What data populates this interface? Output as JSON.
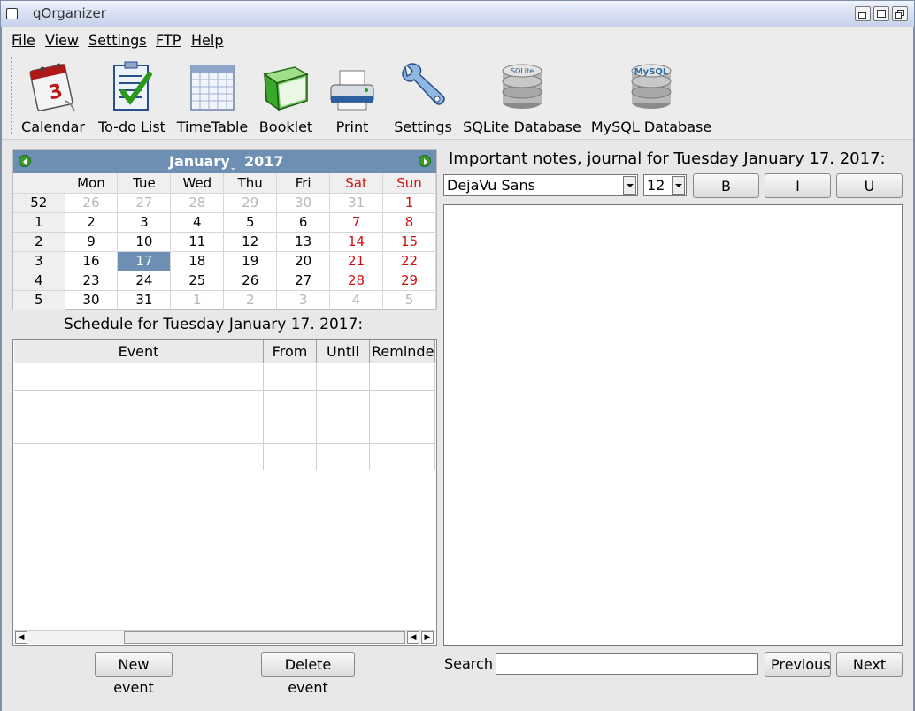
{
  "window": {
    "title": "qOrganizer"
  },
  "menu": [
    "File",
    "View",
    "Settings",
    "FTP",
    "Help"
  ],
  "toolbar": [
    {
      "label": "Calendar",
      "icon": "calendar-icon"
    },
    {
      "label": "To-do List",
      "icon": "todo-list-icon"
    },
    {
      "label": "TimeTable",
      "icon": "timetable-icon"
    },
    {
      "label": "Booklet",
      "icon": "booklet-icon"
    },
    {
      "label": "Print",
      "icon": "printer-icon"
    },
    {
      "label": "Settings",
      "icon": "settings-icon"
    },
    {
      "label": "SQLite Database",
      "icon": "sqlite-database-icon",
      "badge": "SQLite"
    },
    {
      "label": "MySQL Database",
      "icon": "mysql-database-icon",
      "badge": "MySQL"
    }
  ],
  "calendar_icon_day": "3",
  "calendar": {
    "month": "January",
    "year": "2017",
    "day_headers": [
      "Mon",
      "Tue",
      "Wed",
      "Thu",
      "Fri",
      "Sat",
      "Sun"
    ],
    "weeks": [
      {
        "week": "52",
        "days": [
          "26",
          "27",
          "28",
          "29",
          "30",
          "31",
          "1"
        ]
      },
      {
        "week": "1",
        "days": [
          "2",
          "3",
          "4",
          "5",
          "6",
          "7",
          "8"
        ]
      },
      {
        "week": "2",
        "days": [
          "9",
          "10",
          "11",
          "12",
          "13",
          "14",
          "15"
        ]
      },
      {
        "week": "3",
        "days": [
          "16",
          "17",
          "18",
          "19",
          "20",
          "21",
          "22"
        ]
      },
      {
        "week": "4",
        "days": [
          "23",
          "24",
          "25",
          "26",
          "27",
          "28",
          "29"
        ]
      },
      {
        "week": "5",
        "days": [
          "30",
          "31",
          "1",
          "2",
          "3",
          "4",
          "5"
        ]
      }
    ],
    "selected": "17",
    "colors": {
      "header": "#6d8fb4",
      "weekend": "#d01010",
      "outside_month": "#b8b8b8"
    }
  },
  "schedule": {
    "title": "Schedule for Tuesday January 17. 2017:",
    "columns": [
      "Event",
      "From",
      "Until",
      "Reminder"
    ],
    "rows": [
      [
        "",
        "",
        "",
        ""
      ],
      [
        "",
        "",
        "",
        ""
      ],
      [
        "",
        "",
        "",
        ""
      ],
      [
        "",
        "",
        "",
        ""
      ]
    ],
    "new_event_label": "New event",
    "delete_event_label": "Delete event"
  },
  "notes": {
    "title": "Important notes, journal for Tuesday January 17. 2017:",
    "font_family": "DejaVu Sans",
    "font_size": "12",
    "bold_label": "B",
    "italic_label": "I",
    "underline_label": "U",
    "content": ""
  },
  "search": {
    "label": "Search",
    "value": "",
    "previous_label": "Previous",
    "next_label": "Next"
  }
}
